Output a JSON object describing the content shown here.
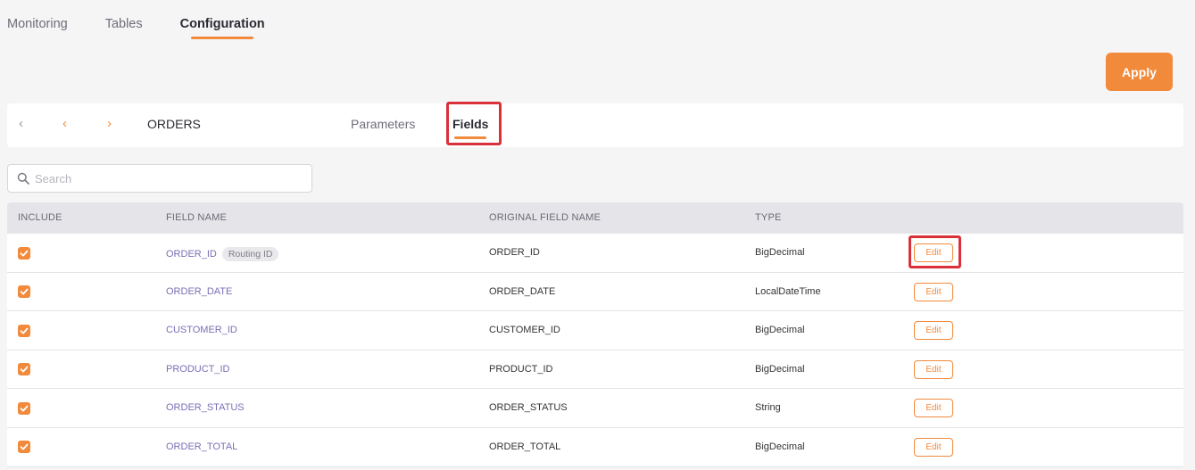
{
  "top_tabs": [
    {
      "label": "Monitoring"
    },
    {
      "label": "Tables"
    },
    {
      "label": "Configuration"
    }
  ],
  "active_top_tab": "Configuration",
  "apply_label": "Apply",
  "subbar": {
    "nav_first": "‹",
    "nav_prev": "‹",
    "nav_next": "›",
    "table_name": "ORDERS",
    "tabs": [
      {
        "label": "Parameters"
      },
      {
        "label": "Fields"
      }
    ],
    "active_tab": "Fields"
  },
  "search": {
    "placeholder": "Search"
  },
  "table": {
    "columns": [
      "INCLUDE",
      "FIELD NAME",
      "ORIGINAL FIELD NAME",
      "TYPE"
    ],
    "rows": [
      {
        "include": true,
        "field_name": "ORDER_ID",
        "badge": "Routing ID",
        "original": "ORDER_ID",
        "type": "BigDecimal",
        "edit": "Edit"
      },
      {
        "include": true,
        "field_name": "ORDER_DATE",
        "original": "ORDER_DATE",
        "type": "LocalDateTime",
        "edit": "Edit"
      },
      {
        "include": true,
        "field_name": "CUSTOMER_ID",
        "original": "CUSTOMER_ID",
        "type": "BigDecimal",
        "edit": "Edit"
      },
      {
        "include": true,
        "field_name": "PRODUCT_ID",
        "original": "PRODUCT_ID",
        "type": "BigDecimal",
        "edit": "Edit"
      },
      {
        "include": true,
        "field_name": "ORDER_STATUS",
        "original": "ORDER_STATUS",
        "type": "String",
        "edit": "Edit"
      },
      {
        "include": true,
        "field_name": "ORDER_TOTAL",
        "original": "ORDER_TOTAL",
        "type": "BigDecimal",
        "edit": "Edit"
      }
    ]
  },
  "colors": {
    "accent": "#f28a3c",
    "highlight": "#d9303a",
    "field_link": "#7a6fb5"
  }
}
